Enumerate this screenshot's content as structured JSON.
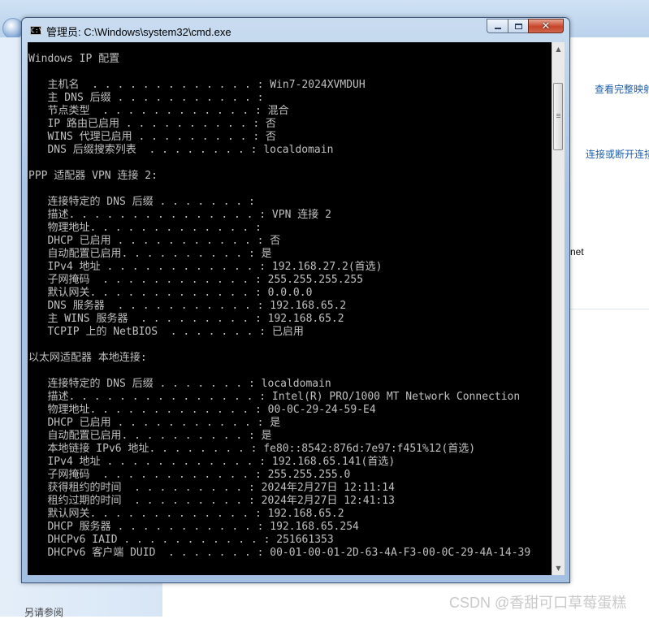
{
  "background_window": {
    "right_links": [
      "查看完整映射",
      "连接或断开连接"
    ],
    "partial_text": "net",
    "see_also": "另请参阅"
  },
  "cmd_window": {
    "title": "管理员: C:\\Windows\\system32\\cmd.exe",
    "icon_text": "C:\\",
    "lines": [
      "Windows IP 配置",
      "",
      "   主机名  . . . . . . . . . . . . . : Win7-2024XVMDUH",
      "   主 DNS 后缀 . . . . . . . . . . . :",
      "   节点类型  . . . . . . . . . . . . : 混合",
      "   IP 路由已启用 . . . . . . . . . . : 否",
      "   WINS 代理已启用 . . . . . . . . . : 否",
      "   DNS 后缀搜索列表  . . . . . . . . : localdomain",
      "",
      "PPP 适配器 VPN 连接 2:",
      "",
      "   连接特定的 DNS 后缀 . . . . . . . :",
      "   描述. . . . . . . . . . . . . . . : VPN 连接 2",
      "   物理地址. . . . . . . . . . . . . :",
      "   DHCP 已启用 . . . . . . . . . . . : 否",
      "   自动配置已启用. . . . . . . . . . : 是",
      "   IPv4 地址 . . . . . . . . . . . . : 192.168.27.2(首选)",
      "   子网掩码  . . . . . . . . . . . . : 255.255.255.255",
      "   默认网关. . . . . . . . . . . . . : 0.0.0.0",
      "   DNS 服务器  . . . . . . . . . . . : 192.168.65.2",
      "   主 WINS 服务器  . . . . . . . . . : 192.168.65.2",
      "   TCPIP 上的 NetBIOS  . . . . . . . : 已启用",
      "",
      "以太网适配器 本地连接:",
      "",
      "   连接特定的 DNS 后缀 . . . . . . . : localdomain",
      "   描述. . . . . . . . . . . . . . . : Intel(R) PRO/1000 MT Network Connection",
      "   物理地址. . . . . . . . . . . . . : 00-0C-29-24-59-E4",
      "   DHCP 已启用 . . . . . . . . . . . : 是",
      "   自动配置已启用. . . . . . . . . . : 是",
      "   本地链接 IPv6 地址. . . . . . . . : fe80::8542:876d:7e97:f451%12(首选)",
      "   IPv4 地址 . . . . . . . . . . . . : 192.168.65.141(首选)",
      "   子网掩码  . . . . . . . . . . . . : 255.255.255.0",
      "   获得租约的时间  . . . . . . . . . : 2024年2月27日 12:11:14",
      "   租约过期的时间  . . . . . . . . . : 2024年2月27日 12:41:13",
      "   默认网关. . . . . . . . . . . . . : 192.168.65.2",
      "   DHCP 服务器 . . . . . . . . . . . : 192.168.65.254",
      "   DHCPv6 IAID . . . . . . . . . . . : 251661353",
      "   DHCPv6 客户端 DUID  . . . . . . . : 00-01-00-01-2D-63-4A-F3-00-0C-29-4A-14-39"
    ]
  },
  "watermark": "CSDN @香甜可口草莓蛋糕"
}
